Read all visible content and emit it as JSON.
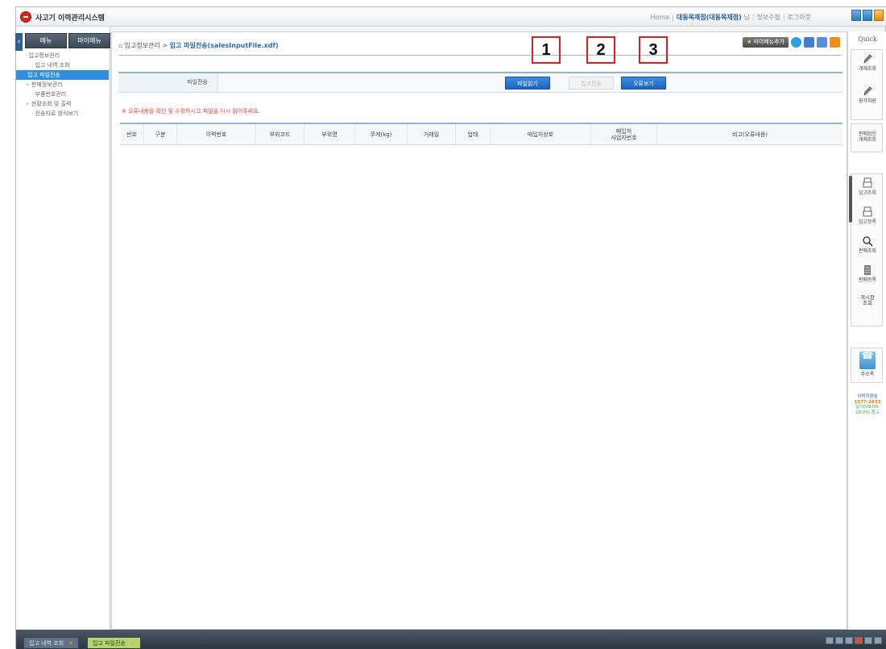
{
  "app": {
    "title": "사고기 이력관리시스템"
  },
  "topmenu": {
    "home": "Home",
    "user": "대동목재점(대동목재점)",
    "user_suffix": "님",
    "edit_info": "정보수정",
    "logout": "로그아웃"
  },
  "leftpanel": {
    "tab_menu": "메뉴",
    "tab_mymenu": "마이메뉴",
    "tree": [
      {
        "label": "입고정보관리",
        "level": 1
      },
      {
        "label": "입고 내역 조회",
        "level": 2
      },
      {
        "label": "입고 파일전송",
        "level": 2,
        "active": true
      },
      {
        "label": "판매정보관리",
        "level": 1
      },
      {
        "label": "부품번호관리",
        "level": 2
      },
      {
        "label": "현황조회 및 출력",
        "level": 1
      },
      {
        "label": "전송자료 양식보기",
        "level": 2
      }
    ]
  },
  "breadcrumb": {
    "parent": "입고정보관리",
    "separator": ">",
    "current": "입고 파일전송(salesInputFile.xdf)"
  },
  "toolbar": {
    "mymenu_add": "마이메뉴추가"
  },
  "callouts": [
    "1",
    "2",
    "3"
  ],
  "searchbar": {
    "label": "파일전송",
    "btn_open": "파일읽기",
    "btn_send": "입고전송",
    "btn_error": "오류보기"
  },
  "notice": "※ 오류내용을 확인 및 수정하시고 파일을 다시 읽어주세요.",
  "grid": {
    "columns": [
      "번호",
      "구분",
      "이력번호",
      "부위코드",
      "부위명",
      "무게(kg)",
      "거래일",
      "업태",
      "매입처상호",
      "매입처\n사업자번호",
      "비고(오류내용)"
    ]
  },
  "quickbar": {
    "title": "Quick",
    "items": [
      "개체조회",
      "원가지원",
      "판매업인\n개체조회",
      "입고조회",
      "입고등록",
      "판매조회",
      "판매등록",
      "게시판\n조회",
      "주소록"
    ],
    "helpdesk_line1": "이력지원실",
    "helpdesk_line2": "1577-2633",
    "helpdesk_line3": "일시(09:00-",
    "helpdesk_line4": "18:00) 참고"
  },
  "bottombar": {
    "tabs": [
      {
        "label": "입고 내역 조회",
        "active": false
      },
      {
        "label": "입고 파일전송",
        "active": true
      }
    ],
    "close_glyph": "✕"
  },
  "colors": {
    "accent": "#2f8ee0",
    "callout": "#e01e1e",
    "button": "#1b62c2",
    "notice": "#e03a3a"
  }
}
